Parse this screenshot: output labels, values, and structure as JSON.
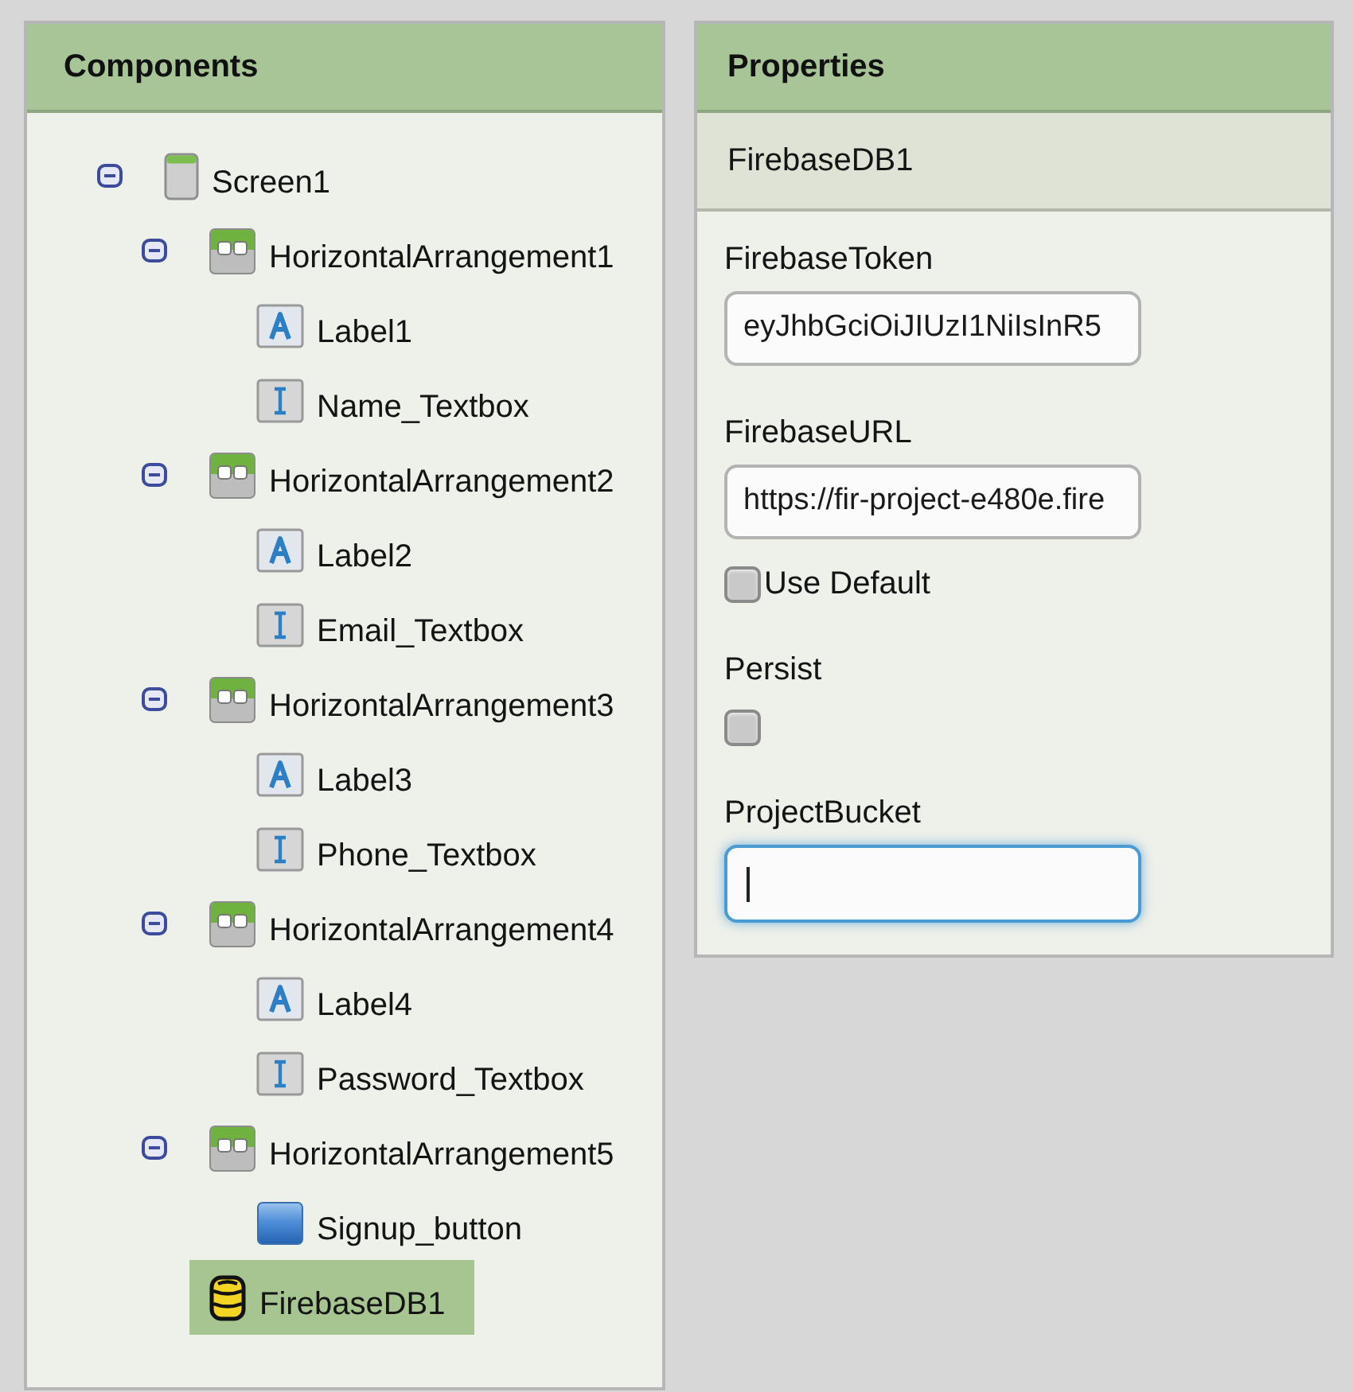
{
  "components": {
    "title": "Components",
    "tree": [
      {
        "label": "Screen1",
        "kind": "screen",
        "expanded": true,
        "selected": false,
        "children": [
          {
            "label": "HorizontalArrangement1",
            "kind": "arrangement",
            "expanded": true,
            "selected": false,
            "children": [
              {
                "label": "Label1",
                "kind": "label",
                "selected": false
              },
              {
                "label": "Name_Textbox",
                "kind": "textbox",
                "selected": false
              }
            ]
          },
          {
            "label": "HorizontalArrangement2",
            "kind": "arrangement",
            "expanded": true,
            "selected": false,
            "children": [
              {
                "label": "Label2",
                "kind": "label",
                "selected": false
              },
              {
                "label": "Email_Textbox",
                "kind": "textbox",
                "selected": false
              }
            ]
          },
          {
            "label": "HorizontalArrangement3",
            "kind": "arrangement",
            "expanded": true,
            "selected": false,
            "children": [
              {
                "label": "Label3",
                "kind": "label",
                "selected": false
              },
              {
                "label": "Phone_Textbox",
                "kind": "textbox",
                "selected": false
              }
            ]
          },
          {
            "label": "HorizontalArrangement4",
            "kind": "arrangement",
            "expanded": true,
            "selected": false,
            "children": [
              {
                "label": "Label4",
                "kind": "label",
                "selected": false
              },
              {
                "label": "Password_Textbox",
                "kind": "textbox",
                "selected": false
              }
            ]
          },
          {
            "label": "HorizontalArrangement5",
            "kind": "arrangement",
            "expanded": true,
            "selected": false,
            "children": [
              {
                "label": "Signup_button",
                "kind": "button",
                "selected": false
              }
            ]
          },
          {
            "label": "FirebaseDB1",
            "kind": "database",
            "selected": true
          }
        ]
      }
    ]
  },
  "properties": {
    "title": "Properties",
    "component": "FirebaseDB1",
    "fields": [
      {
        "kind": "text",
        "label": "FirebaseToken",
        "value": "eyJhbGciOiJIUzI1NiIsInR5",
        "focused": false
      },
      {
        "kind": "text",
        "label": "FirebaseURL",
        "value": "https://fir-project-e480e.fire",
        "focused": false,
        "option": {
          "label": "Use Default",
          "checked": false
        }
      },
      {
        "kind": "checkbox",
        "label": "Persist",
        "checked": false
      },
      {
        "kind": "text",
        "label": "ProjectBucket",
        "focused": true
      }
    ]
  }
}
